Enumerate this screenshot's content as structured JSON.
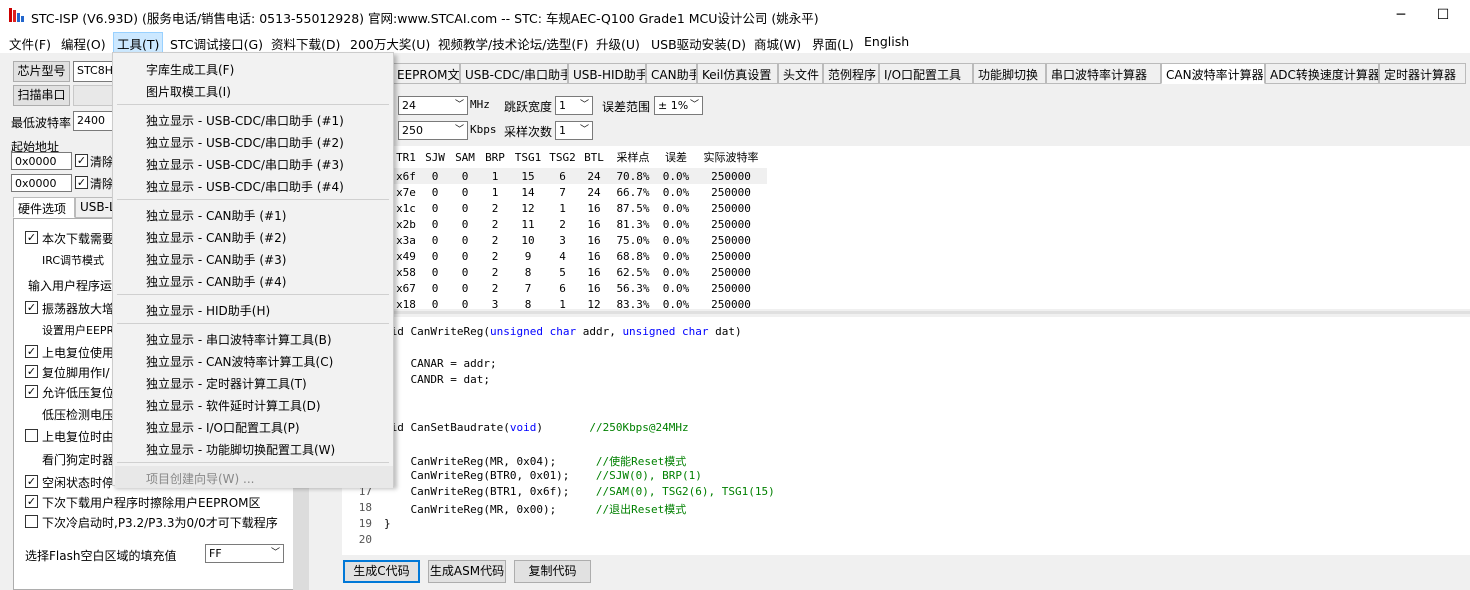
{
  "title": "STC-ISP (V6.93D) (服务电话/销售电话: 0513-55012928) 官网:www.STCAI.com  -- STC: 车规AEC-Q100 Grade1 MCU设计公司 (姚永平)",
  "window": {
    "minimize": "─",
    "maximize": "☐"
  },
  "menu": [
    "文件(F)",
    "编程(O)",
    "工具(T)",
    "STC调试接口(G)",
    "资料下载(D)",
    "200万大奖(U)",
    "视频教学/技术论坛/选型(F)",
    "升级(U)",
    "USB驱动安装(D)",
    "商城(W)",
    "界面(L)",
    "English"
  ],
  "left": {
    "chip_btn": "芯片型号",
    "chip_value": "STC8H",
    "scan_btn": "扫描串口",
    "min_baud_label": "最低波特率",
    "min_baud_value": "2400",
    "start_addr_label": "起始地址",
    "addr1": "0x0000",
    "addr2": "0x0000",
    "clear1": "清除",
    "clear2": "清除",
    "tabs": [
      "硬件选项",
      "USB-L"
    ],
    "options": [
      "本次下载需要",
      "IRC调节模式",
      "输入用户程序运",
      "振荡器放大增",
      "设置用户EEPR",
      "上电复位使用",
      "复位脚用作I/",
      "允许低压复位",
      "低压检测电压",
      "上电复位时由",
      "看门狗定时器",
      "空闲状态时停",
      "下次下载用户程序时擦除用户EEPROM区",
      "下次冷启动时,P3.2/P3.3为0/0才可下载程序"
    ],
    "fill_label": "选择Flash空白区域的填充值",
    "fill_value": "FF"
  },
  "right": {
    "tabs": [
      "EEPROM文件",
      "USB-CDC/串口助手",
      "USB-HID助手",
      "CAN助手",
      "Keil仿真设置",
      "头文件",
      "范例程序",
      "I/O口配置工具",
      "功能脚切换",
      "串口波特率计算器",
      "CAN波特率计算器",
      "ADC转换速度计算器",
      "定时器计算器"
    ],
    "freq_value": "24",
    "freq_unit": "MHz",
    "jump_label": "跳跃宽度",
    "jump_value": "1",
    "err_label": "误差范围",
    "err_value": "± 1%",
    "baud_value": "250",
    "baud_unit": "Kbps",
    "sample_label": "采样次数",
    "sample_value": "1",
    "headers": [
      "TR1",
      "SJW",
      "SAM",
      "BRP",
      "TSG1",
      "TSG2",
      "BTL",
      "采样点",
      "误差",
      "实际波特率"
    ],
    "rows": [
      [
        "x6f",
        "0",
        "0",
        "1",
        "15",
        "6",
        "24",
        "70.8%",
        "0.0%",
        "250000"
      ],
      [
        "x7e",
        "0",
        "0",
        "1",
        "14",
        "7",
        "24",
        "66.7%",
        "0.0%",
        "250000"
      ],
      [
        "x1c",
        "0",
        "0",
        "2",
        "12",
        "1",
        "16",
        "87.5%",
        "0.0%",
        "250000"
      ],
      [
        "x2b",
        "0",
        "0",
        "2",
        "11",
        "2",
        "16",
        "81.3%",
        "0.0%",
        "250000"
      ],
      [
        "x3a",
        "0",
        "0",
        "2",
        "10",
        "3",
        "16",
        "75.0%",
        "0.0%",
        "250000"
      ],
      [
        "x49",
        "0",
        "0",
        "2",
        "9",
        "4",
        "16",
        "68.8%",
        "0.0%",
        "250000"
      ],
      [
        "x58",
        "0",
        "0",
        "2",
        "8",
        "5",
        "16",
        "62.5%",
        "0.0%",
        "250000"
      ],
      [
        "x67",
        "0",
        "0",
        "2",
        "7",
        "6",
        "16",
        "56.3%",
        "0.0%",
        "250000"
      ],
      [
        "x18",
        "0",
        "0",
        "3",
        "8",
        "1",
        "12",
        "83.3%",
        "0.0%",
        "250000"
      ]
    ],
    "code": [
      {
        "n": "",
        "t": "oid CanWriteReg(unsigned char addr, unsigned char dat)"
      },
      {
        "n": "",
        "t": ""
      },
      {
        "n": "",
        "t": "    CANAR = addr;"
      },
      {
        "n": "",
        "t": "    CANDR = dat;"
      },
      {
        "n": "",
        "t": ""
      },
      {
        "n": "",
        "t": ""
      },
      {
        "n": "",
        "t": "oid CanSetBaudrate(void)       //250Kbps@24MHz"
      },
      {
        "n": "",
        "t": ""
      },
      {
        "n": "",
        "t": "    CanWriteReg(MR, 0x04);      //使能Reset模式"
      },
      {
        "n": "",
        "t": "    CanWriteReg(BTR0, 0x01);    //SJW(0), BRP(1)"
      },
      {
        "n": "17",
        "t": "    CanWriteReg(BTR1, 0x6f);    //SAM(0), TSG2(6), TSG1(15)"
      },
      {
        "n": "18",
        "t": "    CanWriteReg(MR, 0x00);      //退出Reset模式"
      },
      {
        "n": "19",
        "t": "}"
      },
      {
        "n": "20",
        "t": ""
      }
    ],
    "gen_c": "生成C代码",
    "gen_asm": "生成ASM代码",
    "copy": "复制代码"
  },
  "dropdown": [
    {
      "label": "字库生成工具(F)"
    },
    {
      "label": "图片取模工具(I)"
    },
    {
      "sep": true
    },
    {
      "label": "独立显示 - USB-CDC/串口助手 (#1)"
    },
    {
      "label": "独立显示 - USB-CDC/串口助手 (#2)"
    },
    {
      "label": "独立显示 - USB-CDC/串口助手 (#3)"
    },
    {
      "label": "独立显示 - USB-CDC/串口助手 (#4)"
    },
    {
      "sep": true
    },
    {
      "label": "独立显示 - CAN助手 (#1)"
    },
    {
      "label": "独立显示 - CAN助手 (#2)"
    },
    {
      "label": "独立显示 - CAN助手 (#3)"
    },
    {
      "label": "独立显示 - CAN助手 (#4)"
    },
    {
      "sep": true
    },
    {
      "label": "独立显示 - HID助手(H)"
    },
    {
      "sep": true
    },
    {
      "label": "独立显示 - 串口波特率计算工具(B)"
    },
    {
      "label": "独立显示 - CAN波特率计算工具(C)"
    },
    {
      "label": "独立显示 - 定时器计算工具(T)"
    },
    {
      "label": "独立显示 - 软件延时计算工具(D)"
    },
    {
      "label": "独立显示 - I/O口配置工具(P)"
    },
    {
      "label": "独立显示 - 功能脚切换配置工具(W)"
    },
    {
      "sep": true
    },
    {
      "label": "项目创建向导(W) ...",
      "disabled": true
    }
  ]
}
